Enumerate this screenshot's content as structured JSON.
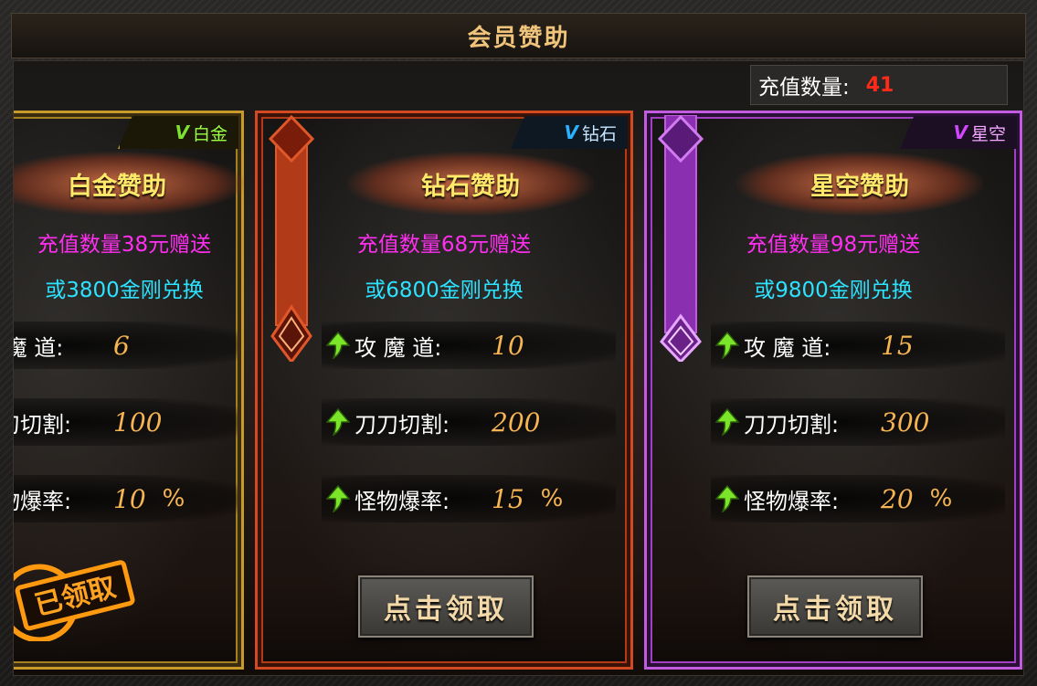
{
  "window": {
    "title": "会员赞助"
  },
  "recharge": {
    "label": "充值数量:",
    "value": "41"
  },
  "cards": [
    {
      "tier": "白金",
      "tag_v": "V",
      "name": "白金赞助",
      "line1": "充值数量38元赠送",
      "line2": "或3800金刚兑换",
      "stats": [
        {
          "label": "攻 魔 道:",
          "value": "6",
          "unit": ""
        },
        {
          "label": "刀刀切割:",
          "value": "100",
          "unit": ""
        },
        {
          "label": "怪物爆率:",
          "value": "10",
          "unit": "%"
        }
      ],
      "claimed_stamp": "已领取",
      "color": "#c89a2a"
    },
    {
      "tier": "钻石",
      "tag_v": "V",
      "name": "钻石赞助",
      "line1": "充值数量68元赠送",
      "line2": "或6800金刚兑换",
      "stats": [
        {
          "label": "攻 魔 道:",
          "value": "10",
          "unit": ""
        },
        {
          "label": "刀刀切割:",
          "value": "200",
          "unit": ""
        },
        {
          "label": "怪物爆率:",
          "value": "15",
          "unit": "%"
        }
      ],
      "button": "点击领取",
      "color": "#d24a22"
    },
    {
      "tier": "星空",
      "tag_v": "V",
      "name": "星空赞助",
      "line1": "充值数量98元赠送",
      "line2": "或9800金刚兑换",
      "stats": [
        {
          "label": "攻 魔 道:",
          "value": "15",
          "unit": ""
        },
        {
          "label": "刀刀切割:",
          "value": "300",
          "unit": ""
        },
        {
          "label": "怪物爆率:",
          "value": "20",
          "unit": "%"
        }
      ],
      "button": "点击领取",
      "color": "#c25be0"
    }
  ]
}
